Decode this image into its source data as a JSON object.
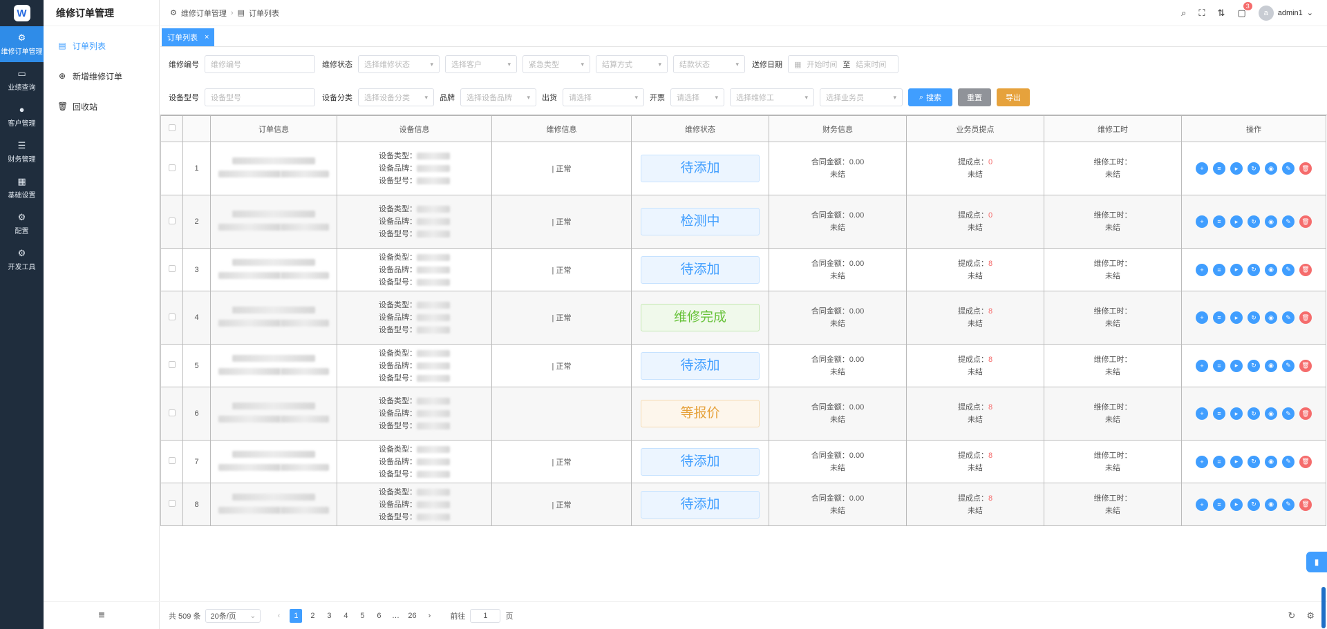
{
  "rail": {
    "items": [
      {
        "label": "维修订单管理",
        "icon": "gear-icon",
        "glyph": "⚙"
      },
      {
        "label": "业绩查询",
        "icon": "monitor-icon",
        "glyph": "▭"
      },
      {
        "label": "客户管理",
        "icon": "user-icon",
        "glyph": "●"
      },
      {
        "label": "财务管理",
        "icon": "database-icon",
        "glyph": "☰"
      },
      {
        "label": "基础设置",
        "icon": "grid-icon",
        "glyph": "▦"
      },
      {
        "label": "配置",
        "icon": "gear-icon",
        "glyph": "⚙"
      },
      {
        "label": "开发工具",
        "icon": "gear-icon",
        "glyph": "⚙"
      }
    ]
  },
  "subnav": {
    "title": "维修订单管理",
    "items": [
      {
        "label": "订单列表",
        "icon": "document-icon",
        "glyph": "▤"
      },
      {
        "label": "新增维修订单",
        "icon": "plus-circle-icon",
        "glyph": "⊕"
      },
      {
        "label": "回收站",
        "icon": "trash-icon",
        "glyph": "🗑"
      }
    ],
    "collapse_glyph": "≡"
  },
  "header": {
    "breadcrumb": [
      "维修订单管理",
      "订单列表"
    ],
    "notification_count": "3",
    "avatar_letter": "a",
    "username": "admin1"
  },
  "tabs": [
    {
      "label": "订单列表",
      "close": "×"
    }
  ],
  "filters": {
    "row1": {
      "order_no_label": "维修编号",
      "order_no_placeholder": "维修编号",
      "status_label": "维修状态",
      "status_placeholder": "选择维修状态",
      "customer_placeholder": "选择客户",
      "urgency_placeholder": "紧急类型",
      "settle_method_placeholder": "结算方式",
      "settle_status_placeholder": "结款状态",
      "date_label": "送修日期",
      "start_placeholder": "开始时间",
      "date_sep": "至",
      "end_placeholder": "结束时间"
    },
    "row2": {
      "model_label": "设备型号",
      "model_placeholder": "设备型号",
      "category_label": "设备分类",
      "category_placeholder": "选择设备分类",
      "brand_label": "品牌",
      "brand_placeholder": "选择设备品牌",
      "shipped_label": "出货",
      "shipped_placeholder": "请选择",
      "invoice_label": "开票",
      "invoice_placeholder": "请选择",
      "technician_placeholder": "选择维修工",
      "salesman_placeholder": "选择业务员",
      "search_label": "搜索",
      "reset_label": "重置",
      "export_label": "导出"
    }
  },
  "table": {
    "columns": [
      "订单信息",
      "设备信息",
      "维修信息",
      "维修状态",
      "财务信息",
      "业务员提点",
      "维修工时",
      "操作"
    ],
    "device_type_label": "设备类型：",
    "device_brand_label": "设备品牌：",
    "device_model_label": "设备型号：",
    "contract_label": "合同金额：",
    "commission_label": "提成点：",
    "hours_label": "维修工时：",
    "rows": [
      {
        "no": "1",
        "repair": "| 正常",
        "status": "待添加",
        "tone": "blue",
        "amount": "0.00",
        "settle": "未结",
        "commission": "0",
        "hours": "未结"
      },
      {
        "no": "2",
        "repair": "| 正常",
        "status": "检测中",
        "tone": "blue",
        "amount": "0.00",
        "settle": "未结",
        "commission": "0",
        "hours": "未结"
      },
      {
        "no": "3",
        "repair": "| 正常",
        "status": "待添加",
        "tone": "blue",
        "amount": "0.00",
        "settle": "未结",
        "commission": "8",
        "hours": "未结"
      },
      {
        "no": "4",
        "repair": "| 正常",
        "status": "维修完成",
        "tone": "green",
        "amount": "0.00",
        "settle": "未结",
        "commission": "8",
        "hours": "未结"
      },
      {
        "no": "5",
        "repair": "| 正常",
        "status": "待添加",
        "tone": "blue",
        "amount": "0.00",
        "settle": "未结",
        "commission": "8",
        "hours": "未结"
      },
      {
        "no": "6",
        "repair": "",
        "status": "等报价",
        "tone": "orange",
        "amount": "0.00",
        "settle": "未结",
        "commission": "8",
        "hours": "未结"
      },
      {
        "no": "7",
        "repair": "| 正常",
        "status": "待添加",
        "tone": "blue",
        "amount": "0.00",
        "settle": "未结",
        "commission": "8",
        "hours": "未结"
      },
      {
        "no": "8",
        "repair": "| 正常",
        "status": "待添加",
        "tone": "blue",
        "amount": "0.00",
        "settle": "未结",
        "commission": "8",
        "hours": "未结"
      }
    ],
    "actions": [
      {
        "name": "add-icon",
        "glyph": "+"
      },
      {
        "name": "database-icon",
        "glyph": "≡"
      },
      {
        "name": "truck-icon",
        "glyph": "▸"
      },
      {
        "name": "refresh-icon",
        "glyph": "↻"
      },
      {
        "name": "eye-icon",
        "glyph": "◉"
      },
      {
        "name": "edit-icon",
        "glyph": "✎"
      },
      {
        "name": "delete-icon",
        "glyph": "🗑"
      }
    ]
  },
  "pagination": {
    "total": "共 509 条",
    "page_size": "20条/页",
    "pages": [
      "1",
      "2",
      "3",
      "4",
      "5",
      "6",
      "…",
      "26"
    ],
    "current": "1",
    "goto_label": "前往",
    "goto_value": "1",
    "page_unit": "页"
  }
}
